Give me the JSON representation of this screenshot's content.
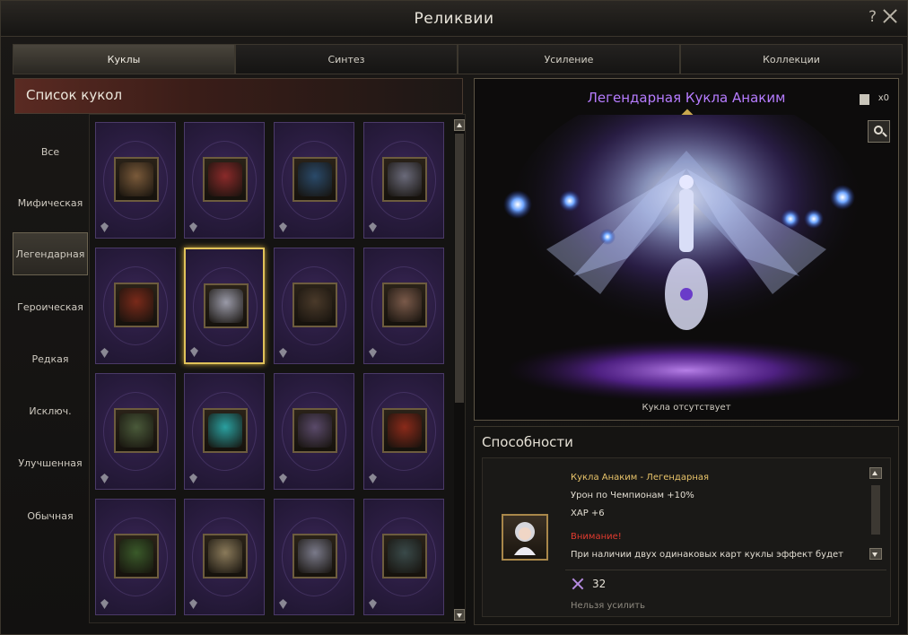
{
  "window": {
    "title": "Реликвии",
    "help_label": "?"
  },
  "tabs": [
    "Куклы",
    "Синтез",
    "Усиление",
    "Коллекции"
  ],
  "list": {
    "header": "Список кукол",
    "categories": [
      "Все",
      "Мифическая",
      "Легендарная",
      "Героическая",
      "Редкая",
      "Исключ.",
      "Улучшенная",
      "Обычная"
    ],
    "active_category": "Легендарная",
    "selected_card": 5
  },
  "card_icons": [
    "girl-doll-icon",
    "red-demon-doll-icon",
    "blue-beast-doll-icon",
    "skull-knight-doll-icon",
    "red-dragon-doll-icon",
    "anakim-doll-icon",
    "dark-beast-doll-icon",
    "tribal-mask-doll-icon",
    "golem-doll-icon",
    "crystal-orb-doll-icon",
    "witch-doll-icon",
    "fire-demon-doll-icon",
    "orc-doll-icon",
    "priest-doll-icon",
    "white-knight-doll-icon",
    "armored-knight-doll-icon"
  ],
  "colors": {
    "accent_purple": "#b67cff",
    "selected_gold": "#e1c25a",
    "warning_red": "#e23b2f",
    "ability_title": "#e9c46a"
  },
  "preview": {
    "name": "Легендарная Кукла Анаким",
    "count": "x0",
    "status": "Кукла отсутствует"
  },
  "abilities": {
    "header": "Способности",
    "title": "Кукла Анаким - Легендарная",
    "line1": "Урон по Чемпионам +10%",
    "line2": "ХАР +6",
    "warning_title": "Внимание!",
    "warning_text": "При наличии двух одинаковых карт куклы эффект будет",
    "stat_value": "32",
    "footer": "Нельзя усилить"
  }
}
